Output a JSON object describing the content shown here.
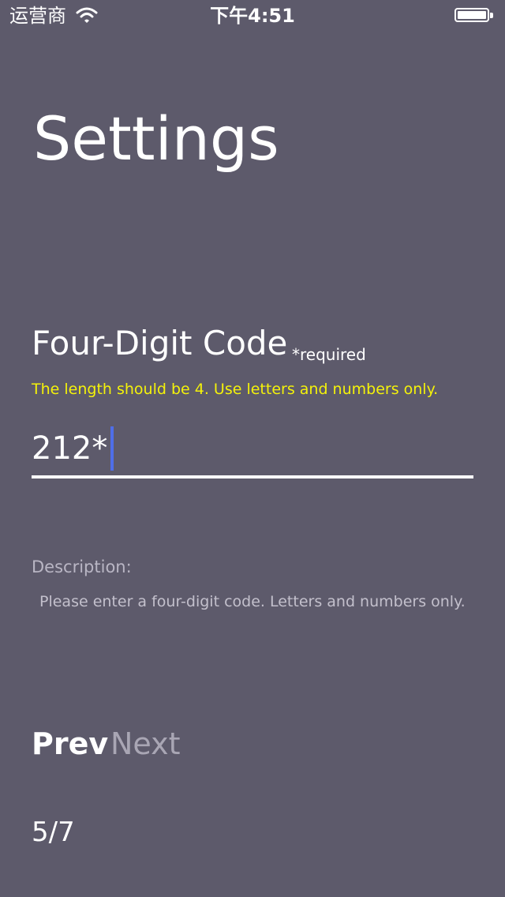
{
  "status_bar": {
    "carrier": "运营商",
    "time": "下午4:51",
    "wifi_icon": "wifi-icon",
    "battery_icon": "battery-icon",
    "battery_level": 1.0
  },
  "page": {
    "title": "Settings"
  },
  "field": {
    "label": "Four-Digit Code",
    "required_note": "*required",
    "validation_message": "The length should be 4. Use letters and numbers only.",
    "value": "212*",
    "cursor_color": "#4f6ee8"
  },
  "description": {
    "label": "Description:",
    "text": "Please enter a four-digit code. Letters and numbers only."
  },
  "navigation": {
    "prev_label": "Prev",
    "next_label": "Next",
    "page_indicator": "5/7"
  },
  "colors": {
    "background": "#5d5a6b",
    "validation": "#f4f20a",
    "text": "#ffffff",
    "muted_text": "#b9b6c4"
  }
}
